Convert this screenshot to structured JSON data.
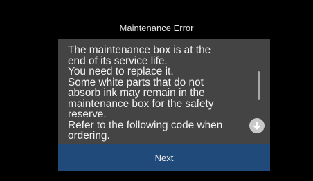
{
  "dialog": {
    "title": "Maintenance Error",
    "message": "The maintenance box is at the\nend of its service life.\nYou need to replace it.\nSome white parts that do not\nabsorb ink may remain in the\nmaintenance box for the safety\nreserve.\nRefer to the following code when\nordering.",
    "next_label": "Next"
  },
  "icons": {
    "scroll_down": "arrow-down-circle-icon"
  },
  "colors": {
    "background": "#000000",
    "panel": "#444444",
    "button": "#1f4a7a",
    "text": "#f2f2f2"
  }
}
